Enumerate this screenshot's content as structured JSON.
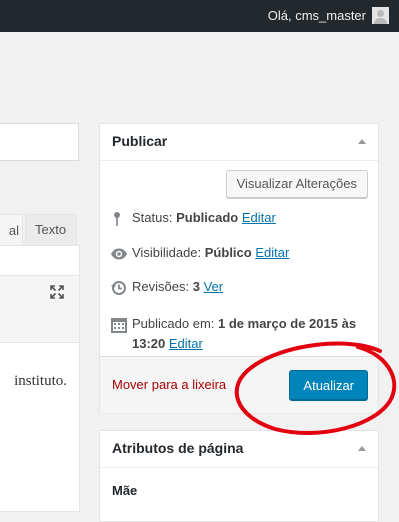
{
  "admin_bar": {
    "greeting": "Olá, cms_master",
    "avatar_icon": "user-avatar-icon"
  },
  "editor": {
    "tabs": {
      "visual": "al",
      "text": "Texto"
    },
    "content_fragment": "instituto."
  },
  "publish_box": {
    "title": "Publicar",
    "preview_button": "Visualizar Alterações",
    "status_label": "Status:",
    "status_value": "Publicado",
    "visibility_label": "Visibilidade:",
    "visibility_value": "Público",
    "revisions_label": "Revisões:",
    "revisions_value": "3",
    "published_label": "Publicado em:",
    "published_value_line1": "1 de março de 2015 às",
    "published_value_line2": "13:20",
    "edit_link": "Editar",
    "view_link": "Ver",
    "trash_link": "Mover para a lixeira",
    "update_button": "Atualizar",
    "icons": [
      "pin-icon",
      "eye-icon",
      "revisions-clock-icon",
      "calendar-icon"
    ]
  },
  "attributes_box": {
    "title": "Atributos de página",
    "parent_label": "Mãe"
  },
  "colors": {
    "admin_bar": "#23282d",
    "link": "#0073aa",
    "primary_button": "#0085ba",
    "trash": "#aa0000",
    "annotation": "#e3000f"
  }
}
